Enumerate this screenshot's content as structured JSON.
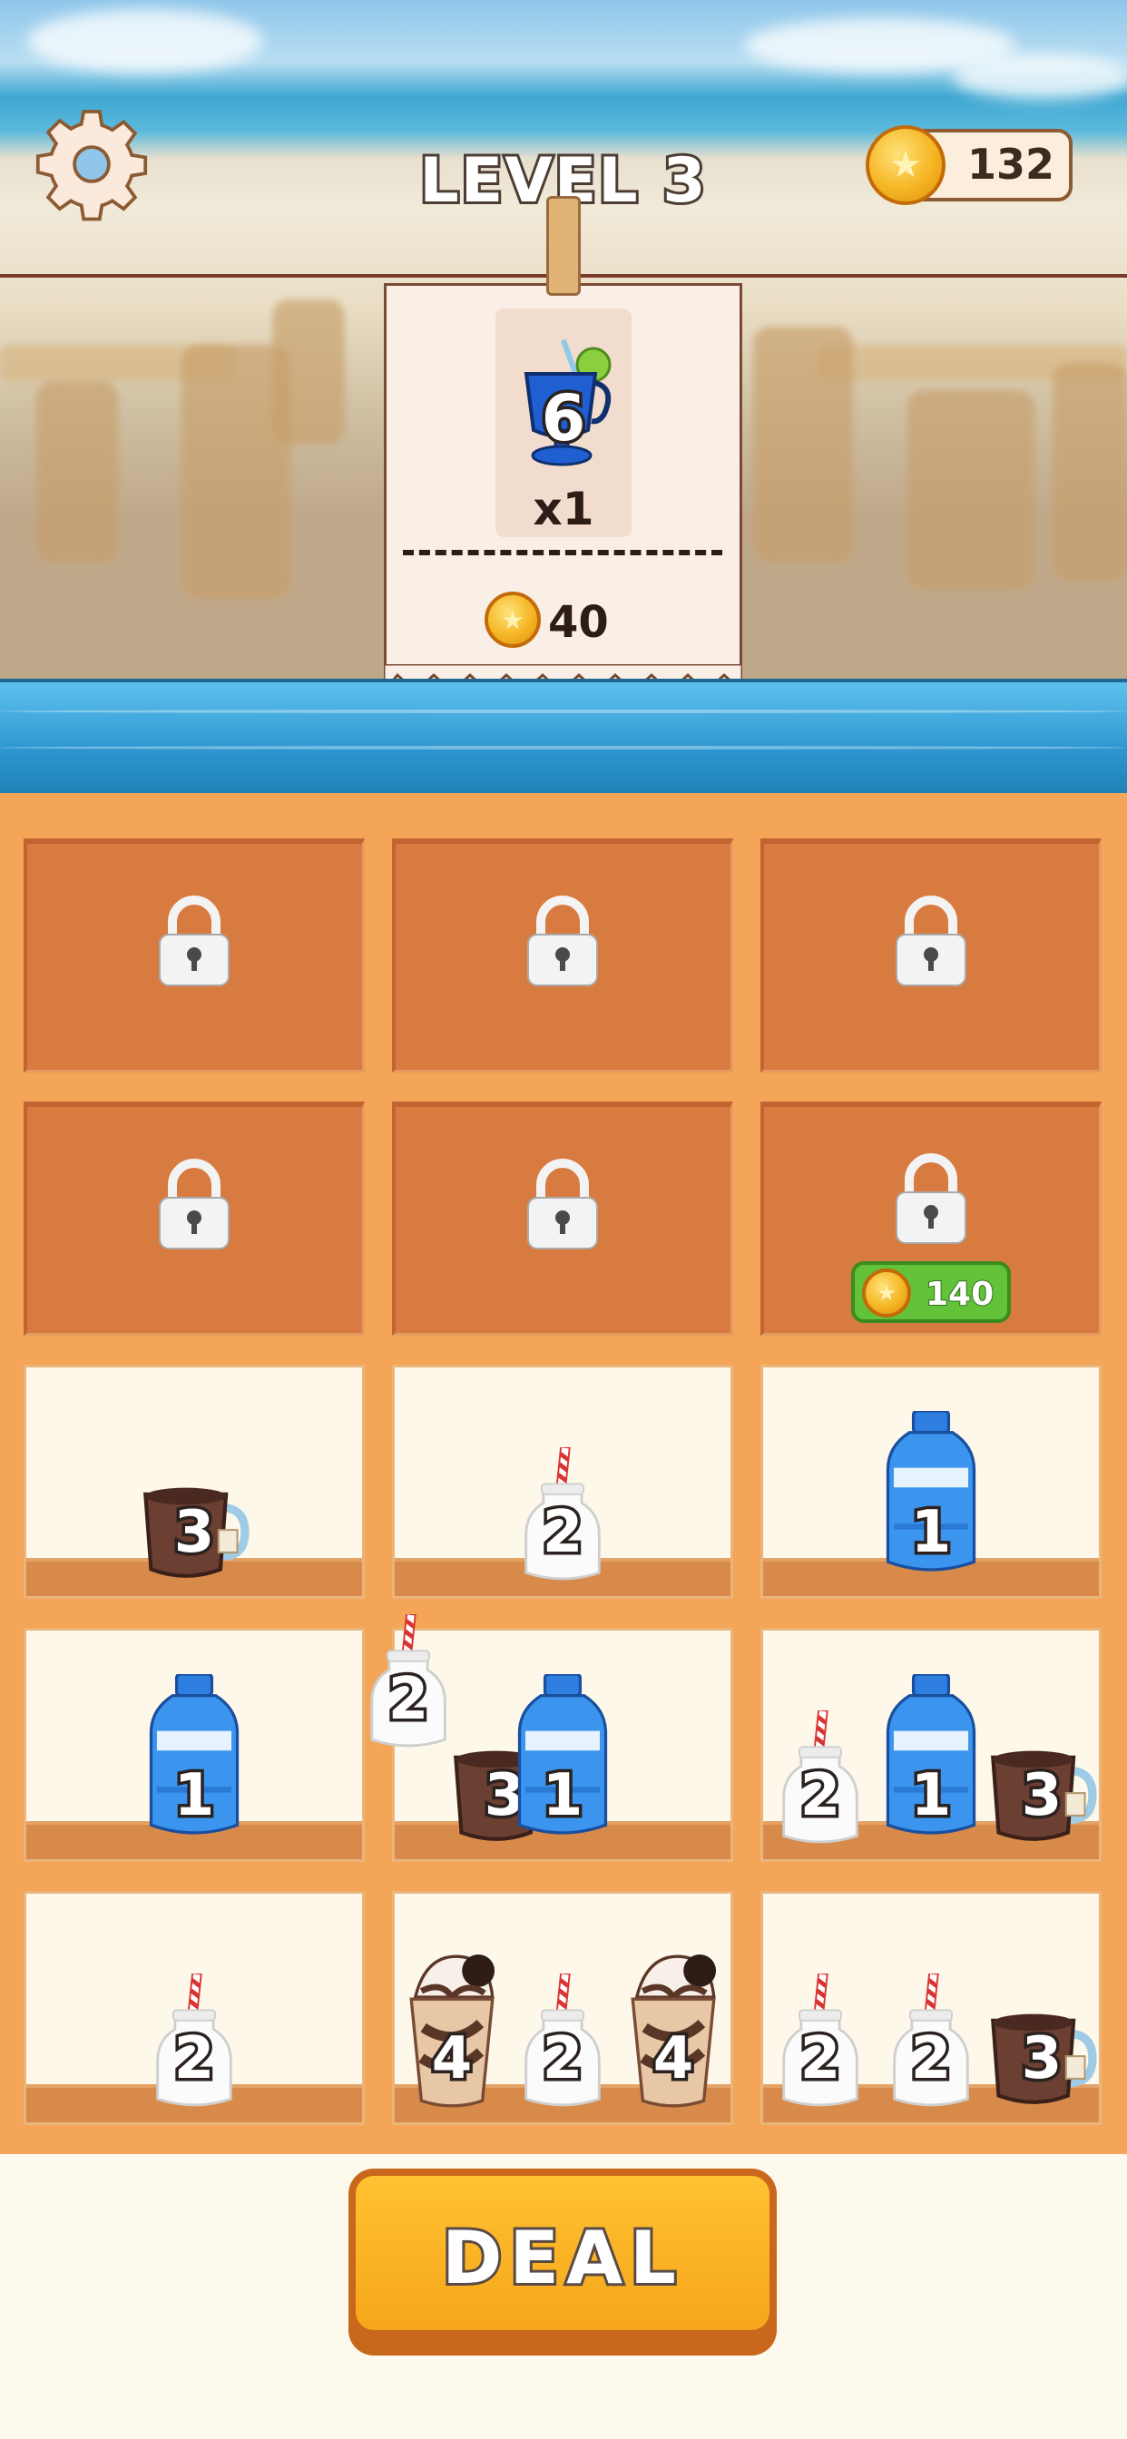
{
  "header": {
    "level_title": "LEVEL 3",
    "coin_balance": "132",
    "settings_icon": "gear-icon",
    "coin_icon": "coin-icon"
  },
  "order": {
    "drink_icon": "blue-cocktail-icon",
    "drink_number": "6",
    "quantity": "x1",
    "reward": "40"
  },
  "shelf": {
    "locked_cells": 6,
    "unlock_price": "140",
    "rows": [
      [
        {
          "items": [
            {
              "type": "coffee-mug",
              "value": "3"
            }
          ]
        },
        {
          "items": [
            {
              "type": "milk-bottle",
              "value": "2"
            }
          ]
        },
        {
          "items": [
            {
              "type": "water-bottle",
              "value": "1"
            }
          ]
        }
      ],
      [
        {
          "items": [
            {
              "type": "water-bottle",
              "value": "1"
            }
          ]
        },
        {
          "items": [
            {
              "type": "coffee-mug",
              "value": "3"
            },
            {
              "type": "water-bottle",
              "value": "1"
            }
          ]
        },
        {
          "items": [
            {
              "type": "milk-bottle",
              "value": "2"
            },
            {
              "type": "water-bottle",
              "value": "1"
            },
            {
              "type": "coffee-mug",
              "value": "3"
            }
          ]
        }
      ],
      [
        {
          "items": [
            {
              "type": "milk-bottle",
              "value": "2"
            }
          ]
        },
        {
          "items": [
            {
              "type": "milkshake",
              "value": "4"
            },
            {
              "type": "milk-bottle",
              "value": "2"
            },
            {
              "type": "milkshake",
              "value": "4"
            }
          ]
        },
        {
          "items": [
            {
              "type": "milk-bottle",
              "value": "2"
            },
            {
              "type": "milk-bottle",
              "value": "2"
            },
            {
              "type": "coffee-mug",
              "value": "3"
            }
          ]
        }
      ]
    ],
    "dragged_item": {
      "type": "milk-bottle",
      "value": "2"
    }
  },
  "actions": {
    "deal_label": "DEAL"
  },
  "colors": {
    "shelf_wood": "#f4a558",
    "locked_cell": "#d87b40",
    "deal_button": "#f6a61a",
    "unlock_badge": "#62c23a"
  }
}
